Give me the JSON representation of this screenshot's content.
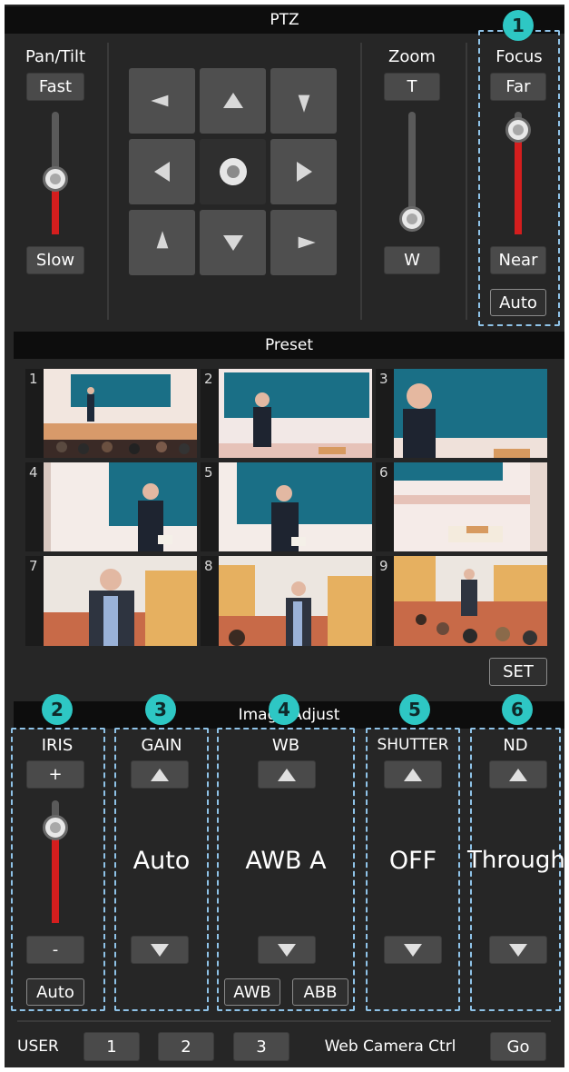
{
  "ptz": {
    "title": "PTZ",
    "pan_tilt_label": "Pan/Tilt",
    "fast_label": "Fast",
    "slow_label": "Slow",
    "pan_tilt_speed_level": 0.45,
    "zoom_label": "Zoom",
    "tele_label": "T",
    "wide_label": "W",
    "zoom_level": 0.0,
    "focus_label": "Focus",
    "far_label": "Far",
    "near_label": "Near",
    "focus_auto_label": "Auto",
    "focus_level": 0.85
  },
  "preset": {
    "title": "Preset",
    "items": [
      {
        "number": "1"
      },
      {
        "number": "2"
      },
      {
        "number": "3"
      },
      {
        "number": "4"
      },
      {
        "number": "5"
      },
      {
        "number": "6"
      },
      {
        "number": "7"
      },
      {
        "number": "8"
      },
      {
        "number": "9"
      }
    ],
    "set_label": "SET"
  },
  "image_adjust": {
    "title": "Image Adjust",
    "iris": {
      "label": "IRIS",
      "plus_label": "+",
      "minus_label": "-",
      "auto_label": "Auto",
      "level": 0.78
    },
    "gain": {
      "label": "GAIN",
      "value": "Auto"
    },
    "wb": {
      "label": "WB",
      "value": "AWB A",
      "awb_label": "AWB",
      "abb_label": "ABB"
    },
    "shutter": {
      "label": "SHUTTER",
      "value": "OFF"
    },
    "nd": {
      "label": "ND",
      "value": "Through"
    }
  },
  "footer": {
    "user_label": "USER",
    "user_buttons": [
      "1",
      "2",
      "3"
    ],
    "web_camera_label": "Web Camera Ctrl",
    "go_label": "Go"
  },
  "callouts": [
    "1",
    "2",
    "3",
    "4",
    "5",
    "6"
  ],
  "colors": {
    "panel": "#262626",
    "header_band": "#0d0d0d",
    "button": "#4a4a4a",
    "slider_fill": "#d41e1e",
    "callout": "#2ec7c4",
    "dashed_frame": "#8fc3e8"
  }
}
